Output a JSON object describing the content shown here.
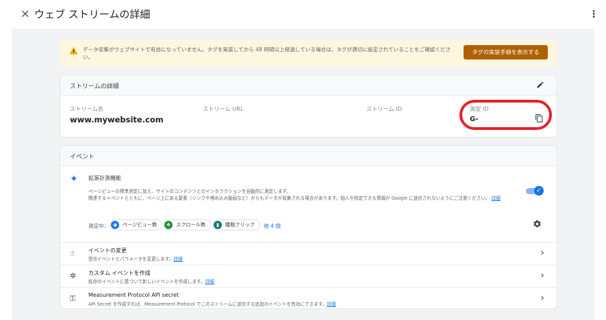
{
  "header": {
    "title": "ウェブ ストリームの詳細",
    "close_icon": "close-icon",
    "more_icon": "more-vert-icon"
  },
  "alert": {
    "text": "データ収集がウェブサイトで有効になっていません。タグを実装してから 48 時間以上経過している場合は、タグが適切に設定されていることをご確認ください。",
    "button_label": "タグの実装手順を表示する",
    "icon": "warning-icon",
    "accent_color": "#b06000"
  },
  "stream_details": {
    "title": "ストリームの詳細",
    "fields": [
      {
        "label": "ストリーム名",
        "value": "www.mywebsite.com"
      },
      {
        "label": "ストリーム URL",
        "value": ""
      },
      {
        "label": "ストリーム ID",
        "value": ""
      },
      {
        "label": "測定 ID",
        "value": "G-"
      }
    ],
    "highlight_color": "#e8202a"
  },
  "events": {
    "title": "イベント",
    "enhanced": {
      "title": "拡張計測機能",
      "desc_line1": "ページビューの標準測定に加え、サイトのコンテンツとのインタラクションを自動的に測定します。",
      "desc_line2": "関連するイベントとともに、ページ上にある要素（リンクや埋め込み動画など）からもデータが収集される場合があります。個人を特定できる情報が Google に送信されないようにご注意ください。",
      "link": "詳細",
      "toggle_on": true,
      "measuring_label": "測定中：",
      "chips": [
        {
          "label": "ページビュー数",
          "icon": "eye-icon",
          "color": "#1a73e8"
        },
        {
          "label": "スクロール数",
          "icon": "scroll-icon",
          "color": "#1e8e3e"
        },
        {
          "label": "離脱クリック",
          "icon": "outbound-click-icon",
          "color": "#12797d"
        }
      ],
      "more": "他 4 個"
    },
    "rows": [
      {
        "title": "イベントの変更",
        "desc": "受信イベントとパラメータを変更します。",
        "link": "詳細",
        "icon": "touch-icon"
      },
      {
        "title": "カスタム イベントを作成",
        "desc": "既存のイベントに基づいて新しいイベントを作成します。",
        "link": "詳細",
        "icon": "sparkle-click-icon"
      },
      {
        "title": "Measurement Protocol API secret",
        "desc": "API Secret を作成すれば、Measurement Protocol でこのストリームに送信する追加のイベントを有効にできます。",
        "link": "詳細",
        "icon": "key-icon"
      }
    ]
  }
}
